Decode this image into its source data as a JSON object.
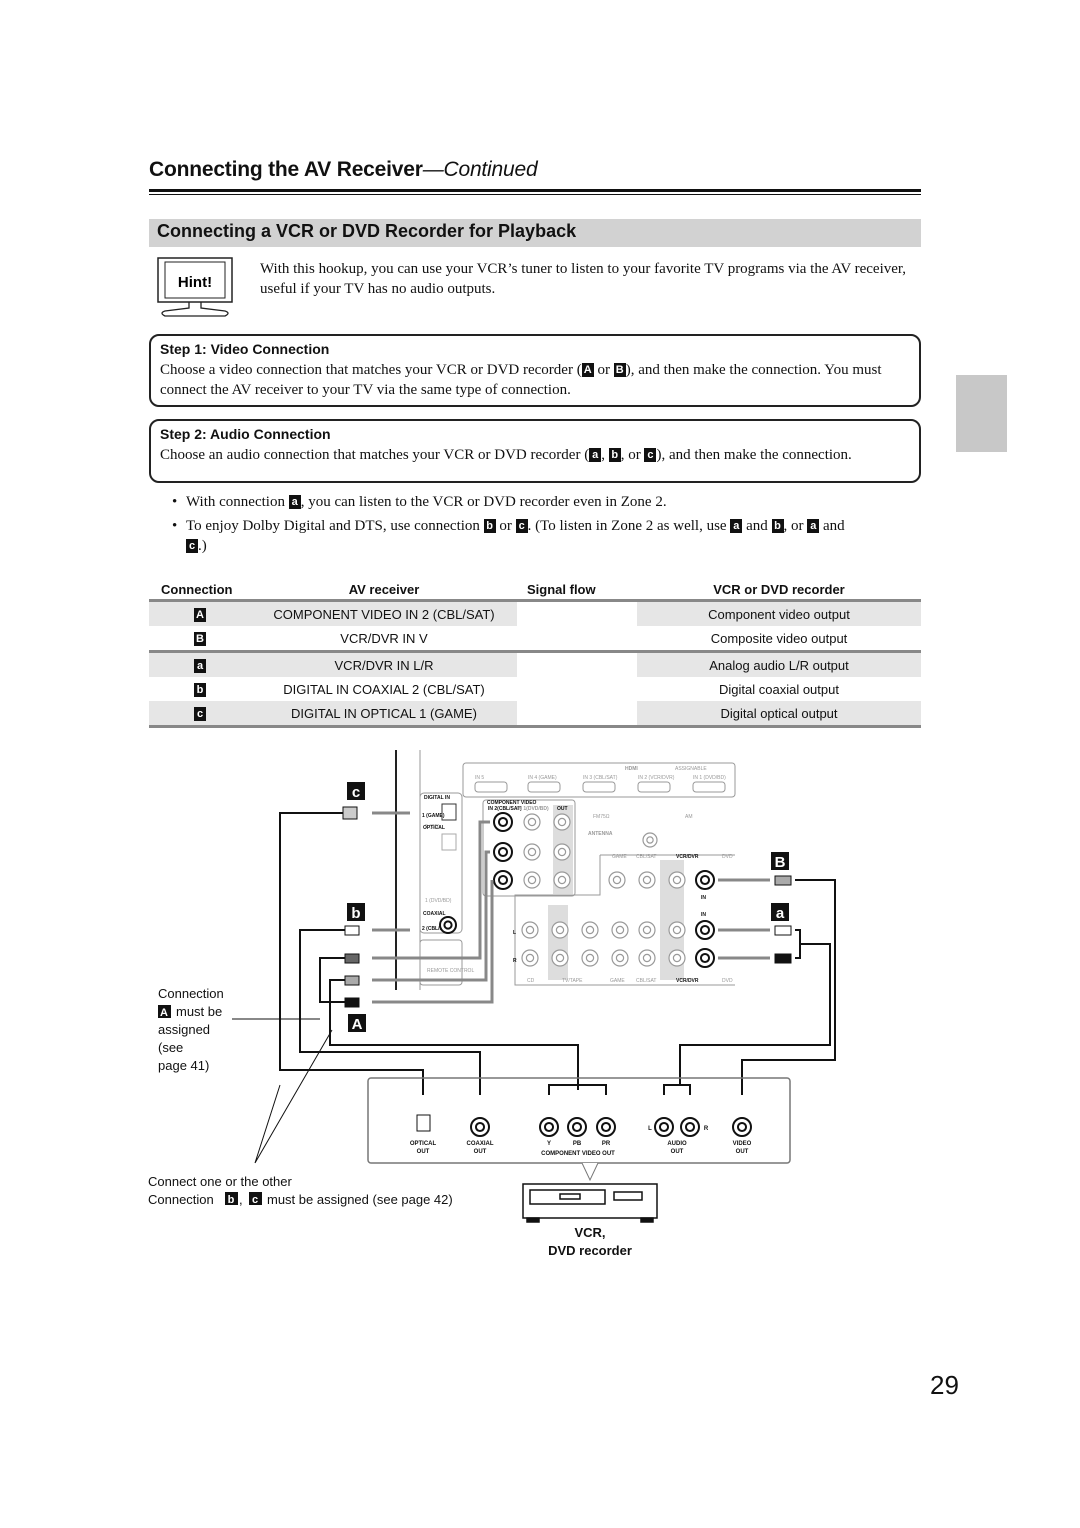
{
  "header": {
    "title": "Connecting the AV Receiver",
    "continued": "—Continued"
  },
  "section": {
    "title": "Connecting a VCR or DVD Recorder for Playback"
  },
  "hint": {
    "label": "Hint!",
    "text": "With this hookup, you can use your VCR’s tuner to listen to your favorite TV programs via the AV receiver, useful if your TV has no audio outputs."
  },
  "step1": {
    "title": "Step 1: Video Connection",
    "text_a": "Choose a video connection that matches your VCR or DVD recorder (",
    "m1": "A",
    "or": " or ",
    "m2": "B",
    "text_b": "), and then make the connection. You must connect the AV receiver to your TV via the same type of connection."
  },
  "step2": {
    "title": "Step 2: Audio Connection",
    "text_a": "Choose an audio connection that matches your VCR or DVD recorder (",
    "m1": "a",
    "c1": ", ",
    "m2": "b",
    "c2": ", or ",
    "m3": "c",
    "text_b": "), and then make the connection."
  },
  "bullets": {
    "b1_a": "With connection ",
    "b1_m": "a",
    "b1_b": ", you can listen to the VCR or DVD recorder even in Zone 2.",
    "b2_a": "To enjoy Dolby Digital and DTS, use connection ",
    "b2_m1": "b",
    "b2_or": " or ",
    "b2_m2": "c",
    "b2_b": ". (To listen in Zone 2 as well, use ",
    "b2_m3": "a",
    "b2_and": " and ",
    "b2_m4": "b",
    "b2_or2": ", or ",
    "b2_m5": "a",
    "b2_and2": " and ",
    "b2_m6": "c",
    "b2_end": ".)"
  },
  "table": {
    "headers": [
      "Connection",
      "AV receiver",
      "Signal flow",
      "VCR or DVD recorder"
    ],
    "rows": [
      {
        "conn": "A",
        "receiver": "COMPONENT VIDEO IN 2 (CBL/SAT)",
        "recorder": "Component video output"
      },
      {
        "conn": "B",
        "receiver": "VCR/DVR IN V",
        "recorder": "Composite video output"
      },
      {
        "conn": "a",
        "receiver": "VCR/DVR IN L/R",
        "recorder": "Analog audio L/R output"
      },
      {
        "conn": "b",
        "receiver": "DIGITAL IN COAXIAL 2 (CBL/SAT)",
        "recorder": "Digital coaxial output"
      },
      {
        "conn": "c",
        "receiver": "DIGITAL IN OPTICAL 1 (GAME)",
        "recorder": "Digital optical output"
      }
    ]
  },
  "diagram": {
    "markers": {
      "c": "c",
      "b": "b",
      "A": "A",
      "B": "B",
      "a": "a"
    },
    "receiver": {
      "hdmi": "HDMI",
      "assignable": "ASSIGNABLE",
      "hdmi_inputs": [
        "IN 5",
        "IN 4 (GAME)",
        "IN 3 (CBL/SAT)",
        "IN 2 (VCR/DVR)",
        "IN 1 (DVD/BD)"
      ],
      "digital_in": "DIGITAL IN",
      "optical": "OPTICAL",
      "coaxial": "COAXIAL",
      "opt1": "1 (GAME)",
      "opt2": "2 (CD)",
      "coax1": "1 (DVD/BD)",
      "coax2": "2 (CBL/SAT)",
      "component_video": "COMPONENT VIDEO",
      "comp_in2": "IN 2(CBL/SAT)",
      "comp_in1": "IN 1(DVD/BD)",
      "comp_out": "OUT",
      "fm": "FM75Ω",
      "am": "AM",
      "antenna": "ANTENNA",
      "video_row": [
        "GAME",
        "CBL/SAT",
        "VCR/DVR",
        "DVD"
      ],
      "audio_row": [
        "CD",
        "TV/TAPE",
        "GAME",
        "CBL/SAT",
        "VCR/DVR",
        "DVD"
      ],
      "in": "IN",
      "out": "OUT",
      "l": "L",
      "r": "R",
      "remote": "REMOTE CONTROL"
    },
    "note_a": [
      "Connection",
      "must be",
      "assigned",
      "(see",
      "page 41)"
    ],
    "note_a_marker": "A",
    "note_bc_1": "Connect one or the other",
    "note_bc_2a": "Connection ",
    "note_bc_m1": "b",
    "note_bc_comma": ", ",
    "note_bc_m2": "c",
    "note_bc_2b": " must be assigned (see page 42)",
    "device_jacks": {
      "optical": [
        "OPTICAL",
        "OUT"
      ],
      "coaxial": [
        "COAXIAL",
        "OUT"
      ],
      "y": "Y",
      "pb": "PB",
      "pr": "PR",
      "component": "COMPONENT VIDEO OUT",
      "l": "L",
      "r": "R",
      "audio": [
        "AUDIO",
        "OUT"
      ],
      "video": [
        "VIDEO",
        "OUT"
      ]
    },
    "device_label": [
      "VCR,",
      "DVD recorder"
    ]
  },
  "page_number": "29",
  "colors": {
    "section_bar": "#d2d2d2",
    "table_shade": "#e6e6e6",
    "marker": "#111111",
    "side_tab": "#c8c8c8"
  }
}
